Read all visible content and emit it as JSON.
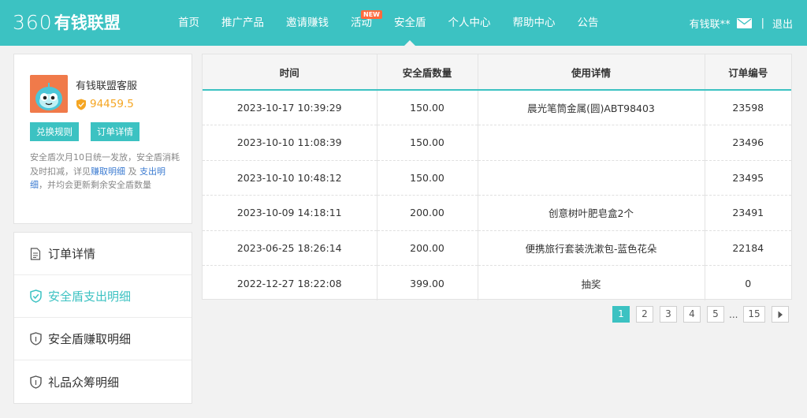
{
  "header": {
    "logo_num": "360",
    "logo_text": "有钱联盟",
    "nav": [
      {
        "label": "首页"
      },
      {
        "label": "推广产品"
      },
      {
        "label": "邀请赚钱"
      },
      {
        "label": "活动",
        "badge": "NEW"
      },
      {
        "label": "安全盾",
        "active": true
      },
      {
        "label": "个人中心"
      },
      {
        "label": "帮助中心"
      },
      {
        "label": "公告"
      }
    ],
    "username": "有钱联**",
    "separator": "|",
    "logout": "退出"
  },
  "profile": {
    "name": "有钱联盟客服",
    "score": "94459.5",
    "exchange_rules_btn": "兑换规则",
    "order_detail_btn": "订单详情",
    "desc_1": "安全盾次月10日统一发放，安全盾消耗及时扣减，详见",
    "desc_link_1": "赚取明细",
    "desc_2": " 及 ",
    "desc_link_2": "支出明细",
    "desc_3": "，并均会更新剩余安全盾数量"
  },
  "menu": [
    {
      "label": "订单详情",
      "icon": "document-icon"
    },
    {
      "label": "安全盾支出明细",
      "icon": "shield-check-icon",
      "active": true
    },
    {
      "label": "安全盾赚取明细",
      "icon": "shield-icon"
    },
    {
      "label": "礼品众筹明细",
      "icon": "shield-icon"
    }
  ],
  "table": {
    "headers": [
      "时间",
      "安全盾数量",
      "使用详情",
      "订单编号"
    ],
    "rows": [
      [
        "2023-10-17 10:39:29",
        "150.00",
        "晨光笔筒金属(圆)ABT98403",
        "23598"
      ],
      [
        "2023-10-10 11:08:39",
        "150.00",
        "",
        "23496"
      ],
      [
        "2023-10-10 10:48:12",
        "150.00",
        "",
        "23495"
      ],
      [
        "2023-10-09 14:18:11",
        "200.00",
        "创意树叶肥皂盒2个",
        "23491"
      ],
      [
        "2023-06-25 18:26:14",
        "200.00",
        "便携旅行套装洗漱包-蓝色花朵",
        "22184"
      ],
      [
        "2022-12-27 18:22:08",
        "399.00",
        "抽奖",
        "0"
      ]
    ]
  },
  "pagination": {
    "pages": [
      "1",
      "2",
      "3",
      "4",
      "5"
    ],
    "ellipsis": "...",
    "last": "15",
    "current": "1"
  },
  "colors": {
    "accent": "#3cc2c2",
    "score": "#f5a623",
    "link": "#3b7bd1",
    "new_badge": "#ff6a3c"
  }
}
